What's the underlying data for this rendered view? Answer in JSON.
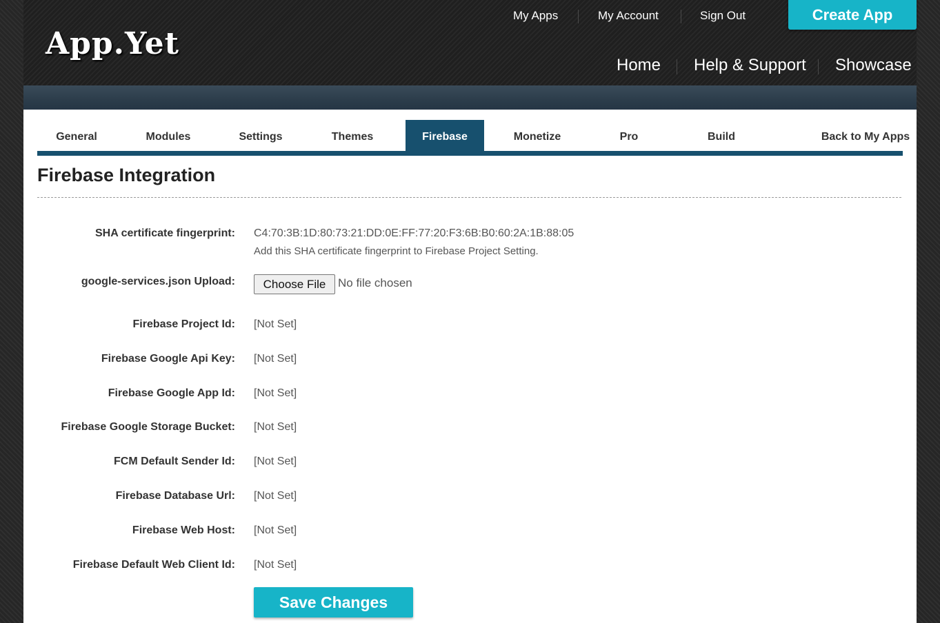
{
  "header": {
    "logo": "App.Yet",
    "top_nav": [
      "My Apps",
      "My Account",
      "Sign Out"
    ],
    "create_app": "Create App",
    "main_nav": [
      "Home",
      "Help & Support",
      "Showcase"
    ]
  },
  "tabs": [
    "General",
    "Modules",
    "Settings",
    "Themes",
    "Firebase",
    "Monetize",
    "Pro",
    "Build",
    "Back to My Apps"
  ],
  "active_tab": "Firebase",
  "page_title": "Firebase Integration",
  "sha": {
    "label": "SHA certificate fingerprint:",
    "value": "C4:70:3B:1D:80:73:21:DD:0E:FF:77:20:F3:6B:B0:60:2A:1B:88:05",
    "hint": "Add this SHA certificate fingerprint to Firebase Project Setting."
  },
  "upload": {
    "label": "google-services.json Upload:",
    "button": "Choose File",
    "status": "No file chosen"
  },
  "fields": [
    {
      "label": "Firebase Project Id:",
      "value": "[Not Set]"
    },
    {
      "label": "Firebase Google Api Key:",
      "value": "[Not Set]"
    },
    {
      "label": "Firebase Google App Id:",
      "value": "[Not Set]"
    },
    {
      "label": "Firebase Google Storage Bucket:",
      "value": "[Not Set]"
    },
    {
      "label": "FCM Default Sender Id:",
      "value": "[Not Set]"
    },
    {
      "label": "Firebase Database Url:",
      "value": "[Not Set]"
    },
    {
      "label": "Firebase Web Host:",
      "value": "[Not Set]"
    },
    {
      "label": "Firebase Default Web Client Id:",
      "value": "[Not Set]"
    }
  ],
  "save_button": "Save Changes",
  "colors": {
    "accent": "#17b4c8",
    "tab_active": "#17506e"
  }
}
